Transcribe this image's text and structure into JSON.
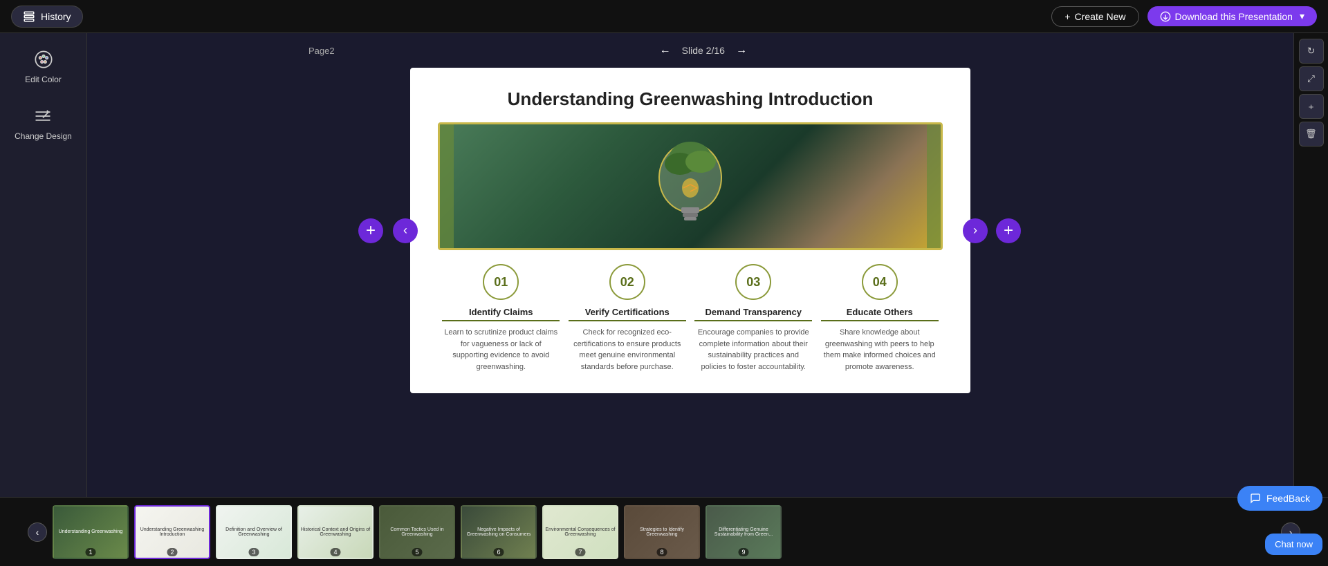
{
  "topbar": {
    "history_label": "History",
    "create_new_label": "Create New",
    "download_label": "Download this Presentation"
  },
  "sidebar": {
    "edit_color_label": "Edit Color",
    "change_design_label": "Change Design"
  },
  "slide_nav": {
    "page_label": "Page2",
    "slide_indicator": "Slide 2/16"
  },
  "slide": {
    "title": "Understanding Greenwashing Introduction",
    "items": [
      {
        "number": "01",
        "title": "Identify Claims",
        "desc": "Learn to scrutinize product claims for vagueness or lack of supporting evidence to avoid greenwashing."
      },
      {
        "number": "02",
        "title": "Verify Certifications",
        "desc": "Check for recognized eco-certifications to ensure products meet genuine environmental standards before purchase."
      },
      {
        "number": "03",
        "title": "Demand Transparency",
        "desc": "Encourage companies to provide complete information about their sustainability practices and policies to foster accountability."
      },
      {
        "number": "04",
        "title": "Educate Others",
        "desc": "Share knowledge about greenwashing with peers to help them make informed choices and promote awareness."
      }
    ]
  },
  "filmstrip": {
    "slides": [
      {
        "number": "1",
        "class": "thumb-1"
      },
      {
        "number": "2",
        "class": "thumb-2"
      },
      {
        "number": "3",
        "class": "thumb-3"
      },
      {
        "number": "4",
        "class": "thumb-4"
      },
      {
        "number": "5",
        "class": "thumb-5"
      },
      {
        "number": "6",
        "class": "thumb-6"
      },
      {
        "number": "7",
        "class": "thumb-7"
      },
      {
        "number": "8",
        "class": "thumb-8"
      },
      {
        "number": "9",
        "class": "thumb-9"
      }
    ]
  },
  "feedback": {
    "label": "FeedBack"
  },
  "chat": {
    "label": "Chat now"
  },
  "icons": {
    "history": "⊟",
    "edit_color": "🎨",
    "change_design": "✏️",
    "plus": "+",
    "chevron_left": "‹",
    "chevron_right": "›",
    "download": "⬇",
    "refresh": "↻",
    "zoom_in": "+",
    "zoom_out": "−",
    "trash": "🗑"
  }
}
